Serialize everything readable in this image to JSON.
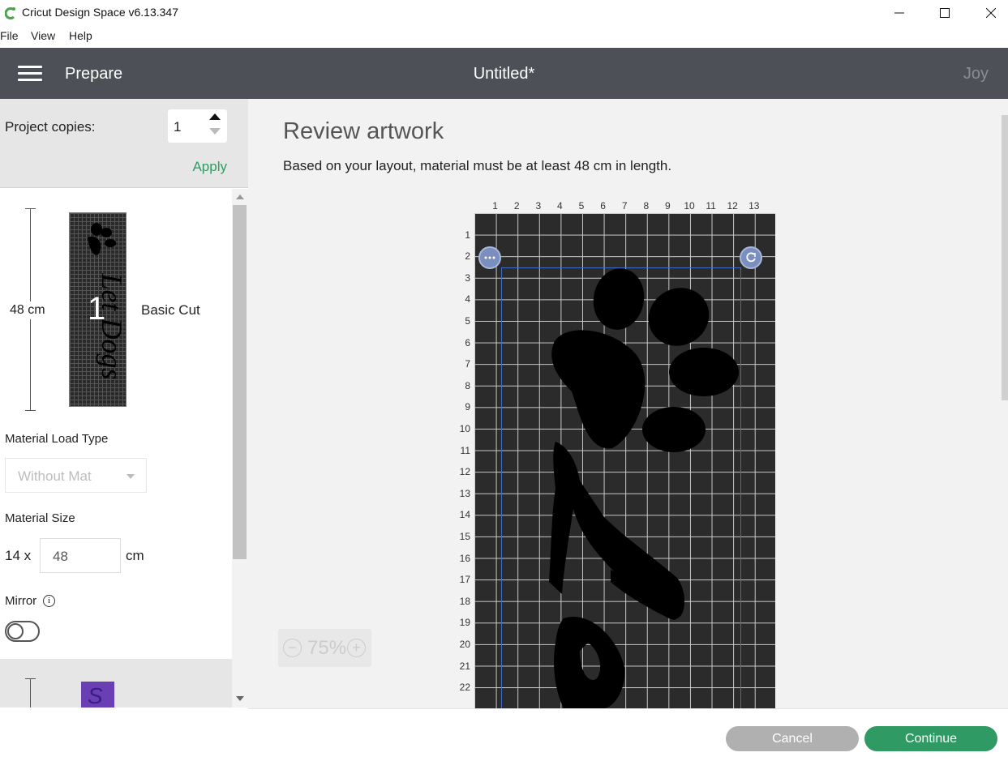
{
  "window": {
    "title": "Cricut Design Space  v6.13.347",
    "menu": [
      "File",
      "View",
      "Help"
    ]
  },
  "header": {
    "section": "Prepare",
    "document": "Untitled*",
    "machine": "Joy"
  },
  "left_panel": {
    "copies_label": "Project copies:",
    "copies_value": "1",
    "apply_label": "Apply",
    "mats": [
      {
        "length": "48 cm",
        "number": "1",
        "operation": "Basic Cut",
        "design_text": "Let Dogs"
      },
      {
        "design_text": "S"
      }
    ],
    "load_type_label": "Material Load Type",
    "load_type_value": "Without Mat",
    "size_label": "Material Size",
    "size_width": "14 x",
    "size_length": "48",
    "size_unit": "cm",
    "mirror_label": "Mirror",
    "mirror_on": false
  },
  "main": {
    "title": "Review artwork",
    "subtitle": "Based on your layout, material must be at least 48 cm in length.",
    "ruler_x": [
      "1",
      "2",
      "3",
      "4",
      "5",
      "6",
      "7",
      "8",
      "9",
      "10",
      "11",
      "12",
      "13"
    ],
    "ruler_y": [
      "1",
      "2",
      "3",
      "4",
      "5",
      "6",
      "7",
      "8",
      "9",
      "10",
      "11",
      "12",
      "13",
      "14",
      "15",
      "16",
      "17",
      "18",
      "19",
      "20",
      "21",
      "22"
    ],
    "zoom": "75%",
    "zoom_out": "−",
    "zoom_in": "+"
  },
  "footer": {
    "cancel": "Cancel",
    "continue": "Continue"
  },
  "colors": {
    "header_bg": "#4d5056",
    "accent_green": "#2f9a63",
    "mat_bg": "#2b2b2b",
    "selection_blue": "#3e6cc5"
  }
}
